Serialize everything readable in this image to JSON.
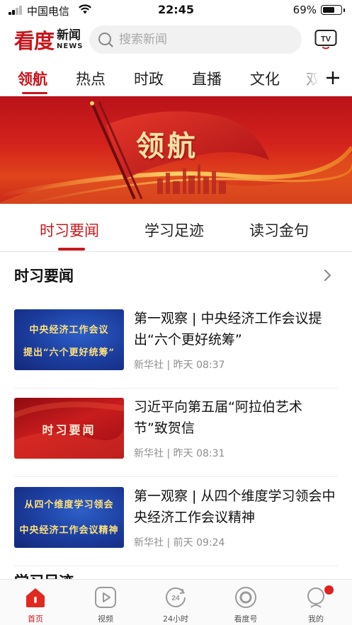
{
  "status_bar": {
    "carrier": "中国电信",
    "time": "22:45",
    "battery": "69%",
    "battery_level": 0.69
  },
  "header": {
    "logo_main": "看度",
    "logo_sub_cn": "新闻",
    "logo_sub_en": "NEWS",
    "search_placeholder": "搜索新闻",
    "tv_label": "TV"
  },
  "channels": {
    "tabs": [
      {
        "label": "领航",
        "active": true
      },
      {
        "label": "热点"
      },
      {
        "label": "时政"
      },
      {
        "label": "直播"
      },
      {
        "label": "文化"
      },
      {
        "label": "双"
      }
    ]
  },
  "banner": {
    "title": "领航"
  },
  "sub_tabs": [
    {
      "label": "时习要闻",
      "active": true
    },
    {
      "label": "学习足迹"
    },
    {
      "label": "读习金句"
    }
  ],
  "section": {
    "title": "时习要闻",
    "items": [
      {
        "thumb_lines": [
          "中央经济工作会议",
          "提出“六个更好统筹”"
        ],
        "title": "第一观察 | 中央经济工作会议提出“六个更好统筹”",
        "source": "新华社",
        "time": "昨天 08:37"
      },
      {
        "thumb_lines": [
          "时习要闻"
        ],
        "title": "习近平向第五届“阿拉伯艺术节”致贺信",
        "source": "新华社",
        "time": "昨天 08:31"
      },
      {
        "thumb_lines": [
          "从四个维度学习领会",
          "中央经济工作会议精神"
        ],
        "title": "第一观察 | 从四个维度学习领会中央经济工作会议精神",
        "source": "新华社",
        "time": "前天 09:24"
      }
    ]
  },
  "next_section_title": "学习足迹",
  "bottom_nav": [
    {
      "label": "首页",
      "icon": "home-icon",
      "active": true
    },
    {
      "label": "视频",
      "icon": "video-play-icon"
    },
    {
      "label": "24小时",
      "icon": "24-hour-icon"
    },
    {
      "label": "看度号",
      "icon": "circle-account-icon"
    },
    {
      "label": "我的",
      "icon": "profile-icon",
      "badge": true
    }
  ],
  "colors": {
    "accent": "#c8161d",
    "muted_text": "#8e8e8e"
  }
}
